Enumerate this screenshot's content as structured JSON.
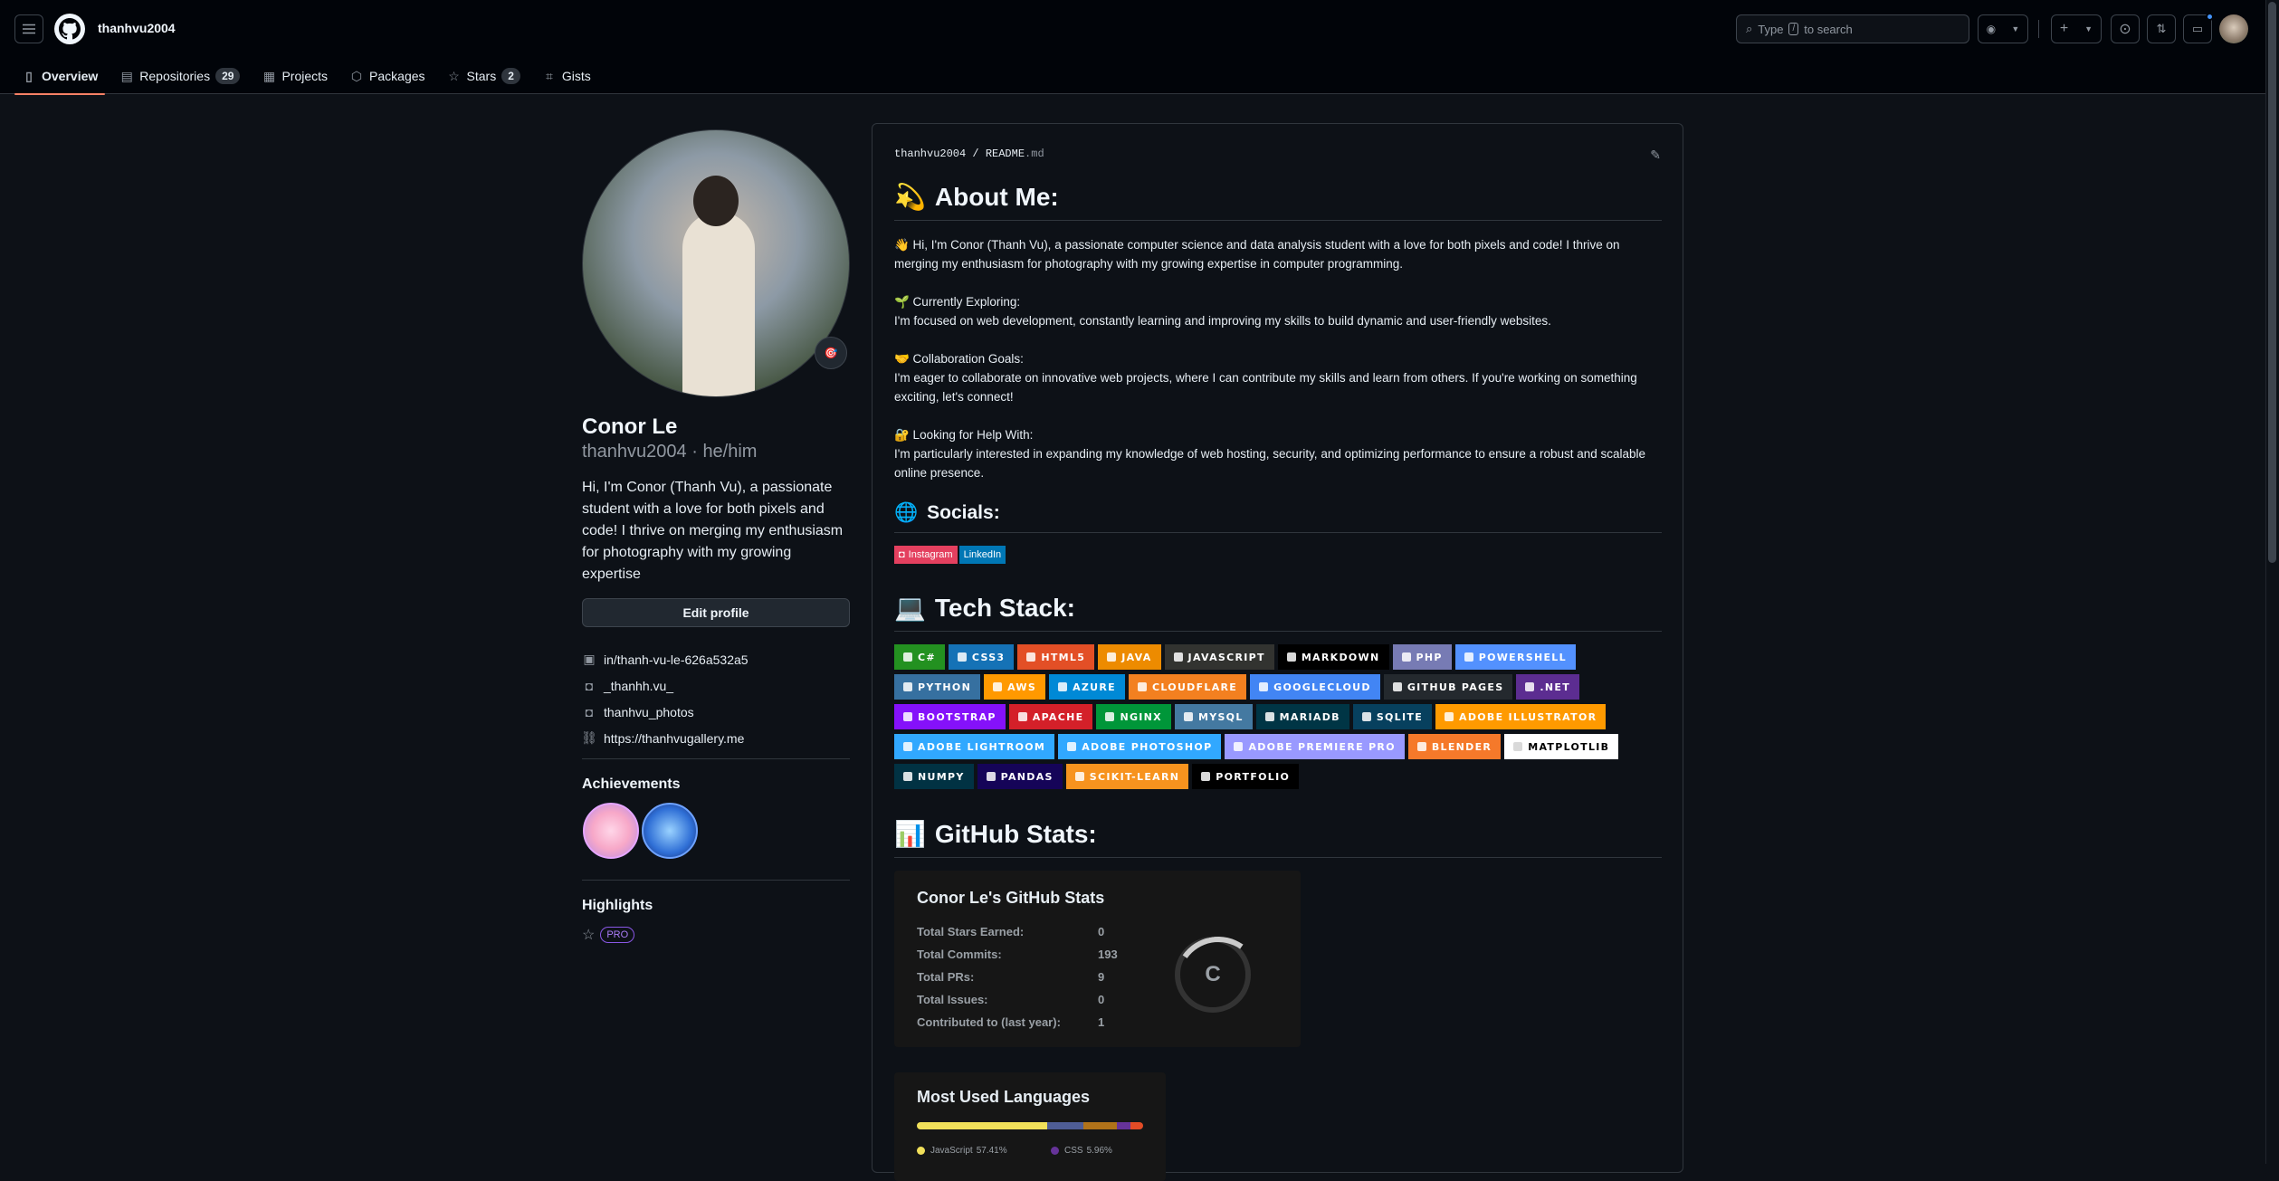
{
  "header": {
    "username": "thanhvu2004",
    "search_placeholder_prefix": "Type",
    "search_key": "/",
    "search_placeholder_suffix": "to search",
    "tabs": [
      {
        "label": "Overview",
        "icon": "book-icon"
      },
      {
        "label": "Repositories",
        "icon": "repo-icon",
        "count": "29"
      },
      {
        "label": "Projects",
        "icon": "table-icon"
      },
      {
        "label": "Packages",
        "icon": "package-icon"
      },
      {
        "label": "Stars",
        "icon": "star-icon",
        "count": "2"
      },
      {
        "label": "Gists",
        "icon": "code-square-icon"
      }
    ]
  },
  "profile": {
    "name": "Conor Le",
    "login_pronouns": "thanhvu2004 · he/him",
    "bio": "Hi, I'm Conor (Thanh Vu), a passionate student with a love for both pixels and code! I thrive on merging my enthusiasm for photography with my growing expertise",
    "edit_label": "Edit profile",
    "links": [
      {
        "icon": "linkedin-icon",
        "text": "in/thanh-vu-le-626a532a5"
      },
      {
        "icon": "instagram-icon",
        "text": "_thanhh.vu_"
      },
      {
        "icon": "instagram-icon",
        "text": "thanhvu_photos"
      },
      {
        "icon": "link-icon",
        "text": "https://thanhvugallery.me"
      }
    ],
    "achievements_title": "Achievements",
    "highlights_title": "Highlights",
    "pro_label": "PRO"
  },
  "readme": {
    "path_user": "thanhvu2004",
    "path_sep": "/",
    "path_file": "README",
    "path_ext": ".md",
    "about_title": "About Me:",
    "about_emoji": "💫",
    "intro": "👋 Hi, I'm Conor (Thanh Vu), a passionate computer science and data analysis student with a love for both pixels and code! I thrive on merging my enthusiasm for photography with my growing expertise in computer programming.",
    "exploring_head": "🌱 Currently Exploring:",
    "exploring": "I'm focused on web development, constantly learning and improving my skills to build dynamic and user-friendly websites.",
    "collab_head": "🤝 Collaboration Goals:",
    "collab": "I'm eager to collaborate on innovative web projects, where I can contribute my skills and learn from others. If you're working on something exciting, let's connect!",
    "help_head": "🔐 Looking for Help With:",
    "help": "I'm particularly interested in expanding my knowledge of web hosting, security, and optimizing performance to ensure a robust and scalable online presence.",
    "socials_title": "Socials:",
    "socials_emoji": "🌐",
    "socials": [
      {
        "label": "Instagram",
        "color": "#e4405f"
      },
      {
        "label": "LinkedIn",
        "color": "#0077b5"
      }
    ],
    "tech_title": "Tech Stack:",
    "tech_emoji": "💻",
    "tech": [
      {
        "label": "c#",
        "color": "#239120"
      },
      {
        "label": "css3",
        "color": "#1572b6"
      },
      {
        "label": "html5",
        "color": "#e34f26"
      },
      {
        "label": "java",
        "color": "#ed8b00"
      },
      {
        "label": "javascript",
        "color": "#323330"
      },
      {
        "label": "markdown",
        "color": "#000000"
      },
      {
        "label": "php",
        "color": "#777bb4"
      },
      {
        "label": "powershell",
        "color": "#5391fe"
      },
      {
        "label": "python",
        "color": "#3670a0"
      },
      {
        "label": "aws",
        "color": "#ff9900"
      },
      {
        "label": "azure",
        "color": "#0089d6"
      },
      {
        "label": "cloudflare",
        "color": "#f38020"
      },
      {
        "label": "googlecloud",
        "color": "#4285f4"
      },
      {
        "label": "github pages",
        "color": "#24292e"
      },
      {
        "label": ".net",
        "color": "#5c2d91"
      },
      {
        "label": "bootstrap",
        "color": "#8511fa"
      },
      {
        "label": "apache",
        "color": "#d42029"
      },
      {
        "label": "nginx",
        "color": "#009639"
      },
      {
        "label": "mysql",
        "color": "#4479a1"
      },
      {
        "label": "mariadb",
        "color": "#003545"
      },
      {
        "label": "sqlite",
        "color": "#07405e"
      },
      {
        "label": "adobe illustrator",
        "color": "#ff9a00"
      },
      {
        "label": "adobe lightroom",
        "color": "#31a8ff"
      },
      {
        "label": "adobe photoshop",
        "color": "#31a8ff"
      },
      {
        "label": "adobe premiere pro",
        "color": "#9999ff"
      },
      {
        "label": "blender",
        "color": "#f5792a"
      },
      {
        "label": "matplotlib",
        "color": "#ffffff"
      },
      {
        "label": "numpy",
        "color": "#013243"
      },
      {
        "label": "pandas",
        "color": "#150458"
      },
      {
        "label": "scikit-learn",
        "color": "#f7931e"
      },
      {
        "label": "portfolio",
        "color": "#000000"
      }
    ],
    "stats_title": "GitHub Stats:",
    "stats_emoji": "📊",
    "stats_card_title": "Conor Le's GitHub Stats",
    "stats": [
      {
        "label": "Total Stars Earned:",
        "value": "0"
      },
      {
        "label": "Total Commits:",
        "value": "193"
      },
      {
        "label": "Total PRs:",
        "value": "9"
      },
      {
        "label": "Total Issues:",
        "value": "0"
      },
      {
        "label": "Contributed to (last year):",
        "value": "1"
      }
    ],
    "rank": "C",
    "langs_title": "Most Used Languages",
    "langs": [
      {
        "name": "JavaScript",
        "pct": "57.41%",
        "value": 57.41,
        "color": "#f1e05a"
      },
      {
        "name": "CSS",
        "pct": "5.96%",
        "value": 21,
        "color": "#663399"
      }
    ],
    "lang_bar": [
      {
        "value": 57.41,
        "color": "#f1e05a"
      },
      {
        "value": 16,
        "color": "#4F5D95"
      },
      {
        "value": 15,
        "color": "#b07219"
      },
      {
        "value": 6,
        "color": "#663399"
      },
      {
        "value": 5.59,
        "color": "#e34c26"
      }
    ]
  }
}
